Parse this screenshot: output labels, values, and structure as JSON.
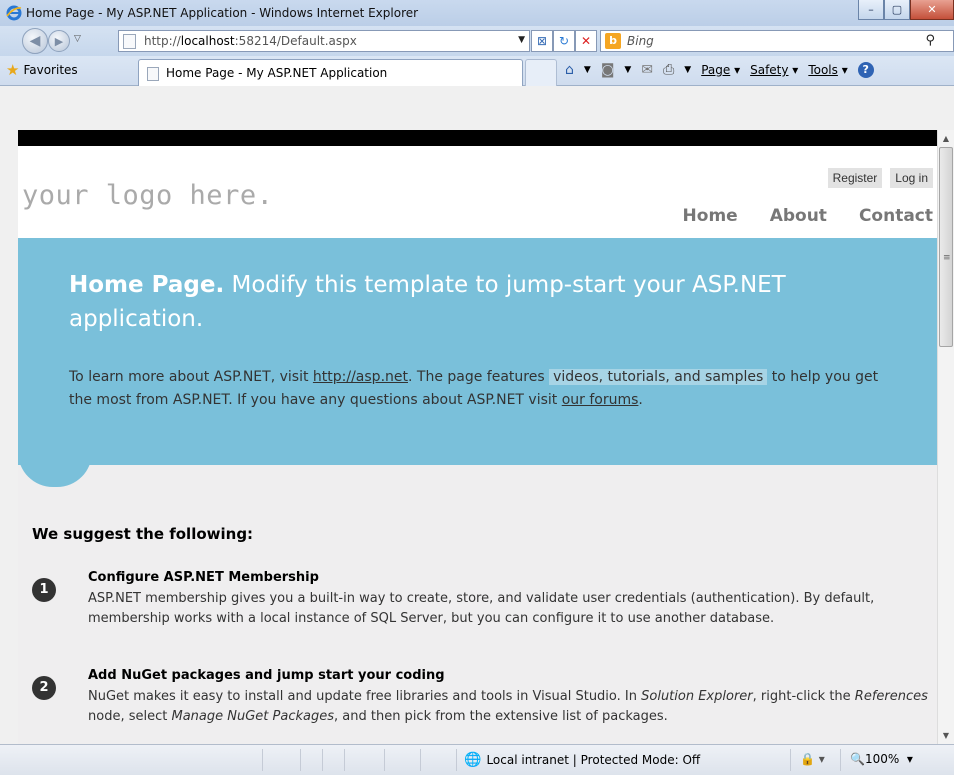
{
  "window": {
    "title": "Home Page - My ASP.NET Application - Windows Internet Explorer",
    "minimize": "–",
    "maximize": "▢",
    "close": "✕"
  },
  "address_bar": {
    "url_prefix": "http://",
    "url_host": "localhost",
    "url_rest": ":58214/Default.aspx",
    "search_engine": "Bing"
  },
  "favorites_bar": {
    "favorites_label": "Favorites",
    "tab_title": "Home Page - My ASP.NET Application"
  },
  "command_bar": {
    "page": "Page",
    "safety": "Safety",
    "tools": "Tools"
  },
  "site": {
    "logo": "your logo here.",
    "register": "Register",
    "login": "Log in",
    "menu": [
      "Home",
      "About",
      "Contact"
    ]
  },
  "featured": {
    "title_bold": "Home Page.",
    "title_rest": "Modify this template to jump-start your ASP.NET application.",
    "p1": "To learn more about ASP.NET, visit",
    "link1": "http://asp.net",
    "p2": ". The page features",
    "highlight": "videos, tutorials, and samples",
    "p3": "to help you get the most from ASP.NET. If you have any questions about ASP.NET visit",
    "link2": "our forums",
    "p4": "."
  },
  "content": {
    "heading": "We suggest the following:",
    "steps": [
      {
        "num": "1",
        "title": "Configure ASP.NET Membership",
        "desc": "ASP.NET membership gives you a built-in way to create, store, and validate user credentials (authentication). By default, membership works with a local instance of SQL Server, but you can configure it to use another database."
      },
      {
        "num": "2",
        "title": "Add NuGet packages and jump start your coding",
        "desc_a": "NuGet makes it easy to install and update free libraries and tools in Visual Studio. In",
        "desc_b": "Solution Explorer",
        "desc_c": ", right-click the",
        "desc_d": "References",
        "desc_e": "node, select",
        "desc_f": "Manage NuGet Packages",
        "desc_g": ", and then pick from the extensive list of packages."
      }
    ]
  },
  "status_bar": {
    "zone": "Local intranet | Protected Mode: Off",
    "zoom": "100%"
  }
}
